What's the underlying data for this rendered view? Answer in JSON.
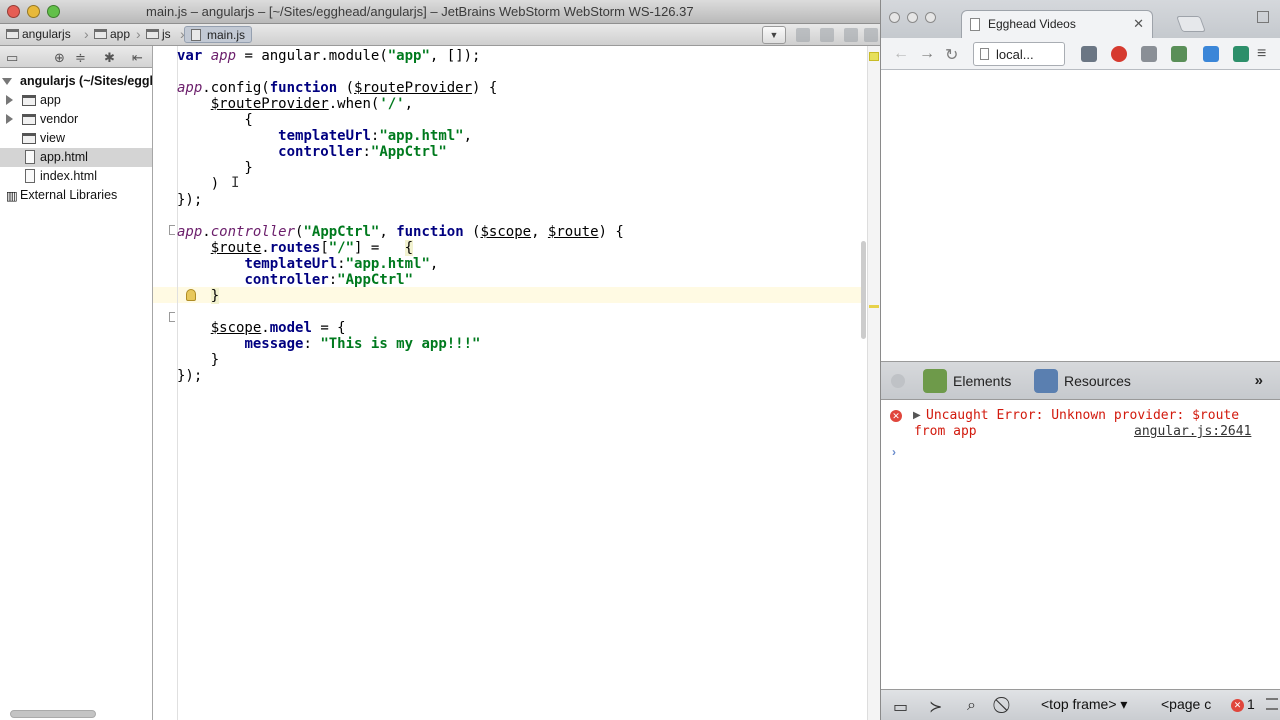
{
  "ide": {
    "window_title": "main.js – angularjs – [~/Sites/egghead/angularjs] – JetBrains WebStorm WebStorm WS-126.37",
    "breadcrumbs": [
      "angularjs",
      "app",
      "js",
      "main.js"
    ],
    "project_tree": [
      {
        "label": "angularjs (~/Sites/egghead/angularjs)",
        "type": "root"
      },
      {
        "label": "app",
        "type": "folder"
      },
      {
        "label": "vendor",
        "type": "folder"
      },
      {
        "label": "view",
        "type": "folder"
      },
      {
        "label": "app.html",
        "type": "file",
        "selected": true
      },
      {
        "label": "index.html",
        "type": "file"
      },
      {
        "label": "External Libraries",
        "type": "library"
      }
    ]
  },
  "browser": {
    "tab_title": "Egghead Videos",
    "omnibox_text": "local...",
    "devtools": {
      "tabs": [
        "Elements",
        "Resources"
      ],
      "more_label": "»",
      "console_error": {
        "line1": "Uncaught Error: Unknown provider: $route",
        "line2": "from app",
        "source_link": "angular.js:2641"
      },
      "frame_select": "<top frame>",
      "page_select": "<page c",
      "error_count": "1"
    }
  },
  "colors": {
    "keyword": "#000080",
    "string": "#007a1e",
    "identifier": "#6b1e6b",
    "error": "#d21a0d"
  }
}
